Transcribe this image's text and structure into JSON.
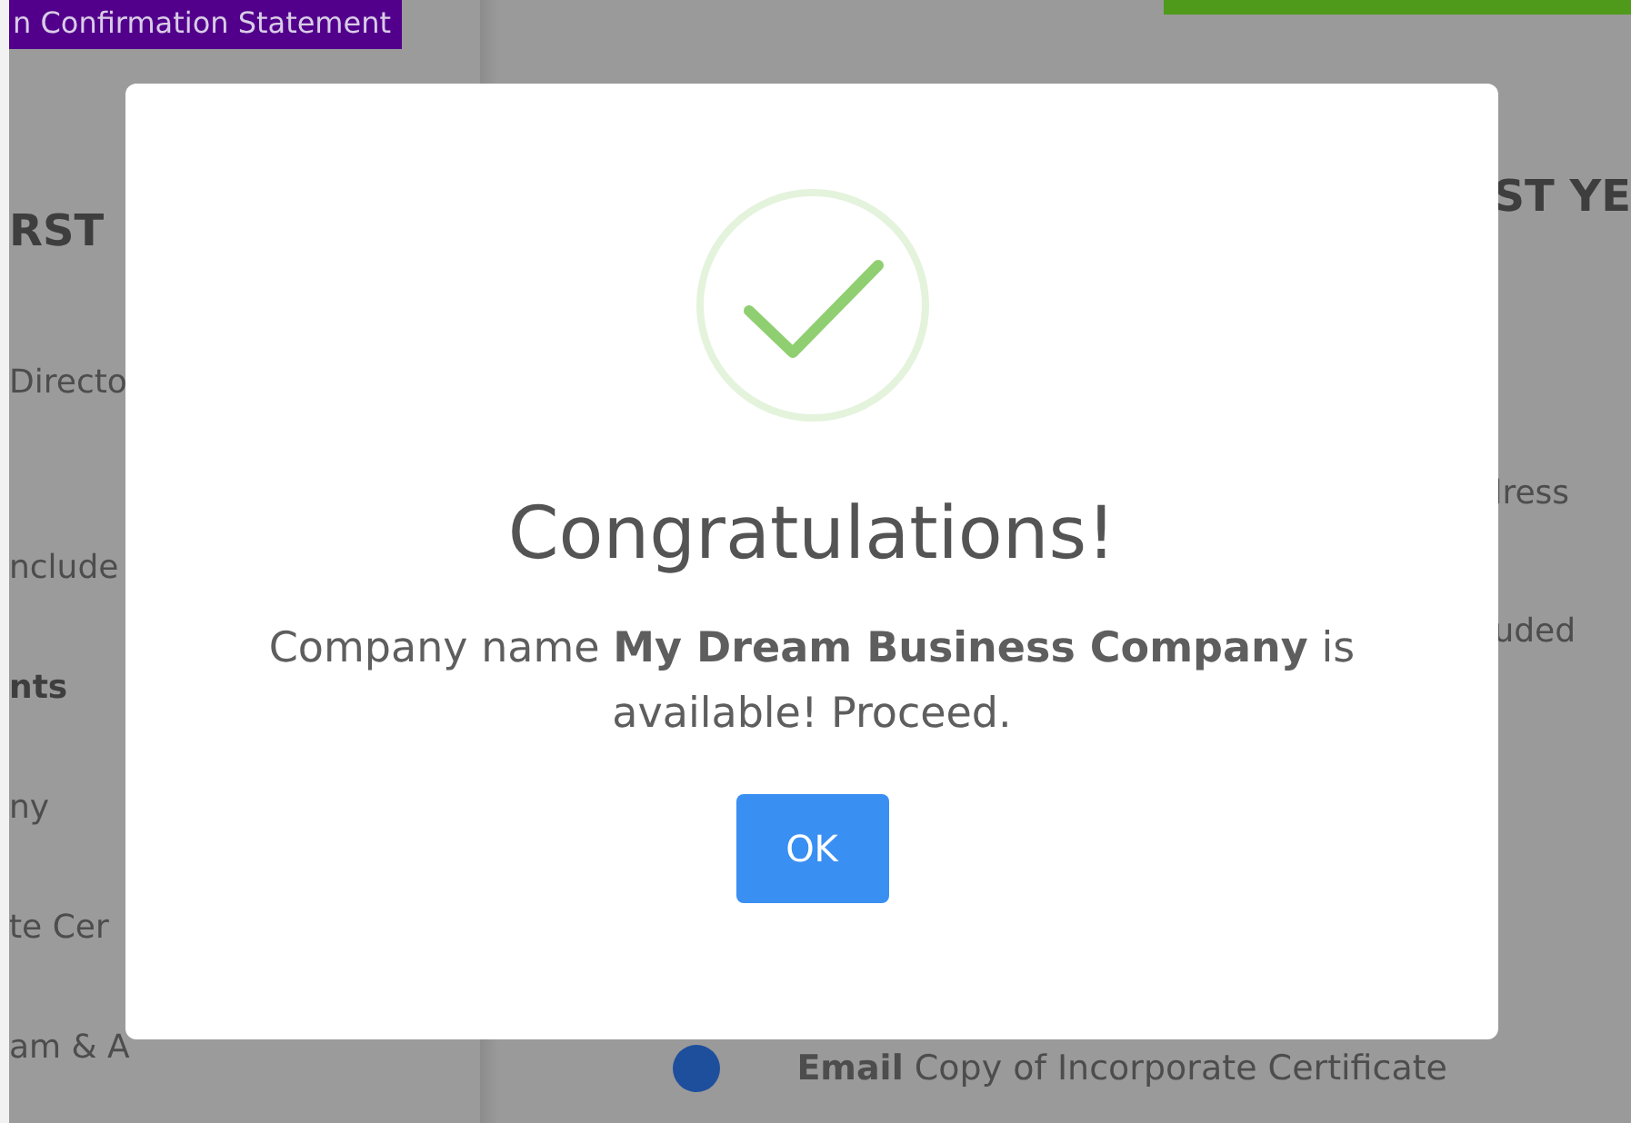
{
  "background": {
    "banner": "n Confirmation Statement",
    "left_items": [
      {
        "text": "RST",
        "kind": "heading"
      },
      {
        "text": "Directo",
        "kind": "item"
      },
      {
        "text": "nclude",
        "kind": "item"
      },
      {
        "text": "nts",
        "kind": "heading"
      },
      {
        "text": "ny",
        "kind": "item"
      },
      {
        "text": "te Cer",
        "kind": "item"
      },
      {
        "text": "am & A",
        "kind": "item"
      }
    ],
    "right_items": [
      {
        "text": "ST YE",
        "kind": "heading"
      },
      {
        "text": "lress",
        "kind": "item"
      },
      {
        "text": "uded",
        "kind": "item"
      }
    ],
    "footer_item": "**Email** Copy of Incorporate Certificate"
  },
  "dialog": {
    "title": "Congratulations!",
    "message": "Company name **My Dream Business Company** is available! Proceed.",
    "button": "OK"
  }
}
